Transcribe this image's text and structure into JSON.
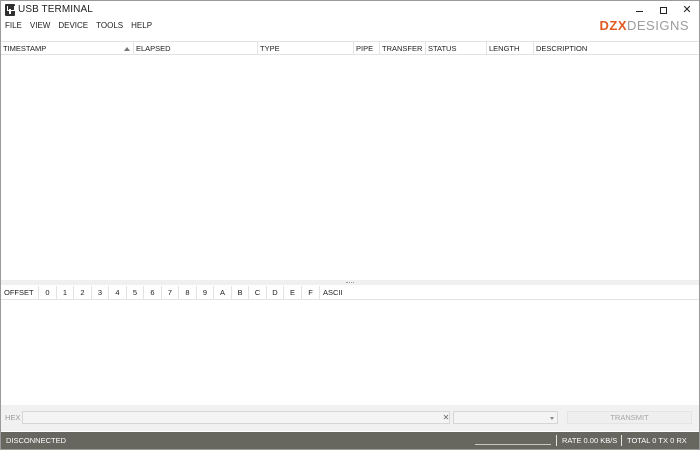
{
  "window": {
    "title": "USB TERMINAL"
  },
  "menu": [
    "FILE",
    "VIEW",
    "DEVICE",
    "TOOLS",
    "HELP"
  ],
  "logo": {
    "part1": "DZX",
    "part2": "DESIGNS",
    "accent": "#e05a22",
    "grey": "#9c9c9c"
  },
  "transfer_table": {
    "columns": [
      "TIMESTAMP",
      "ELAPSED",
      "TYPE",
      "PIPE",
      "TRANSFER",
      "STATUS",
      "LENGTH",
      "DESCRIPTION"
    ],
    "sorted_column": "TIMESTAMP",
    "rows": []
  },
  "hex_table": {
    "columns": [
      "OFFSET",
      "0",
      "1",
      "2",
      "3",
      "4",
      "5",
      "6",
      "7",
      "8",
      "9",
      "A",
      "B",
      "C",
      "D",
      "E",
      "F",
      "ASCII"
    ],
    "rows": []
  },
  "input": {
    "label": "HEX",
    "value": "",
    "dropdown_value": "",
    "transmit_label": "TRANSMIT"
  },
  "status": {
    "connection": "DISCONNECTED",
    "rate": "RATE  0.00 KB/S",
    "total": "TOTAL  0 TX  0 RX",
    "bar_color": "#67675f"
  },
  "icons": [
    "usb-icon",
    "minimize-icon",
    "maximize-icon",
    "close-icon",
    "sort-ascending-icon",
    "clear-icon",
    "dropdown-arrow-icon",
    "splitter-grip-icon"
  ]
}
